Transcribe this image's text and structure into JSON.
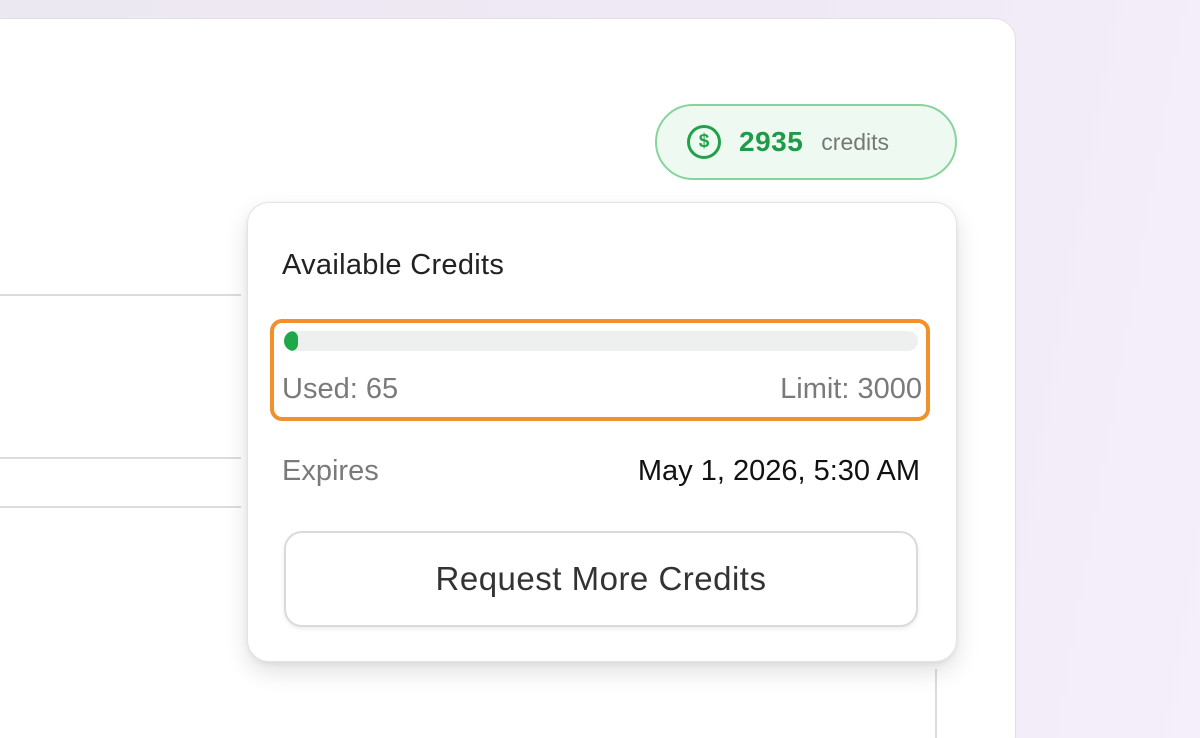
{
  "credits_badge": {
    "icon": "dollar-coin-icon",
    "icon_glyph": "$",
    "count": "2935",
    "unit": "credits",
    "accent_color": "#1f9a48"
  },
  "popover": {
    "title": "Available Credits",
    "usage": {
      "used_label": "Used: 65",
      "limit_label": "Limit: 3000",
      "used": 65,
      "limit": 3000,
      "fill_color": "#1fa84a",
      "highlight_color": "#f0912b"
    },
    "expires": {
      "label": "Expires",
      "value": "May 1, 2026, 5:30 AM"
    },
    "request_button_label": "Request More Credits"
  }
}
